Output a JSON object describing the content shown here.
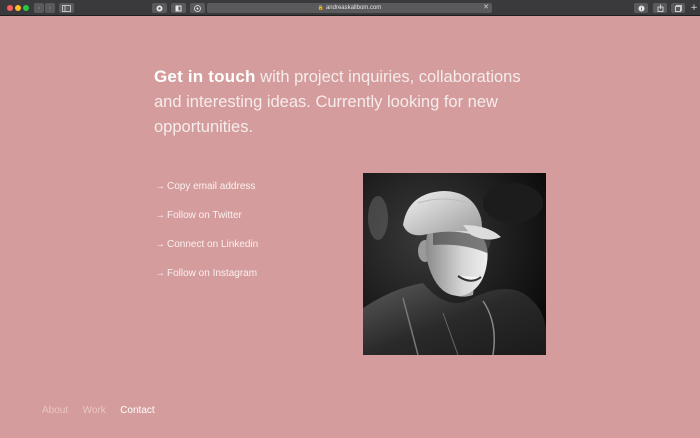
{
  "browser": {
    "url": "andreaskallbom.com",
    "lock_glyph": "🔒",
    "close_glyph": "✕",
    "back_glyph": "‹",
    "forward_glyph": "›",
    "new_tab_glyph": "+"
  },
  "intro": {
    "lead": "Get in touch",
    "rest": " with project inquiries, collaborations and interesting ideas. Currently looking for new opportunities."
  },
  "links": [
    {
      "arrow": "→",
      "label": "Copy email address"
    },
    {
      "arrow": "→",
      "label": "Follow on Twitter"
    },
    {
      "arrow": "→",
      "label": "Connect on Linkedin"
    },
    {
      "arrow": "→",
      "label": "Follow on Instagram"
    }
  ],
  "nav": {
    "about": "About",
    "work": "Work",
    "contact": "Contact"
  },
  "colors": {
    "background": "#d49c9c",
    "text": "#fbf1f1"
  }
}
